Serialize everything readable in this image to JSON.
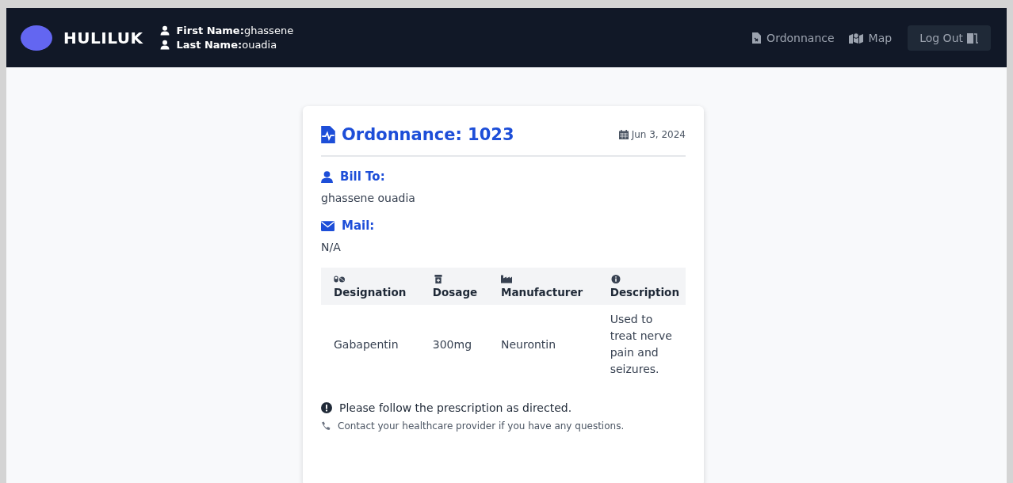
{
  "navbar": {
    "brand": "HULILUK",
    "user": [
      {
        "label": "First Name:",
        "value": "ghassene"
      },
      {
        "label": "Last Name:",
        "value": "ouadia"
      }
    ],
    "links": [
      {
        "label": "Ordonnance"
      },
      {
        "label": "Map"
      }
    ],
    "logout": "Log Out"
  },
  "card": {
    "title": "Ordonnance: 1023",
    "date": "Jun 3, 2024",
    "sections": [
      {
        "kind": "person",
        "heading": "Bill To:",
        "value": "ghassene ouadia"
      },
      {
        "kind": "mail",
        "heading": "Mail:",
        "value": "N/A"
      }
    ],
    "table": {
      "columns": [
        "Designation",
        "Dosage",
        "Manufacturer",
        "Description"
      ],
      "rows": [
        [
          "Gabapentin",
          "300mg",
          "Neurontin",
          "Used to treat nerve pain and seizures."
        ]
      ]
    },
    "notes": [
      {
        "kind": "warning",
        "text": "Please follow the prescription as directed."
      },
      {
        "kind": "phone",
        "text": "Contact your healthcare provider if you have any questions."
      }
    ]
  }
}
